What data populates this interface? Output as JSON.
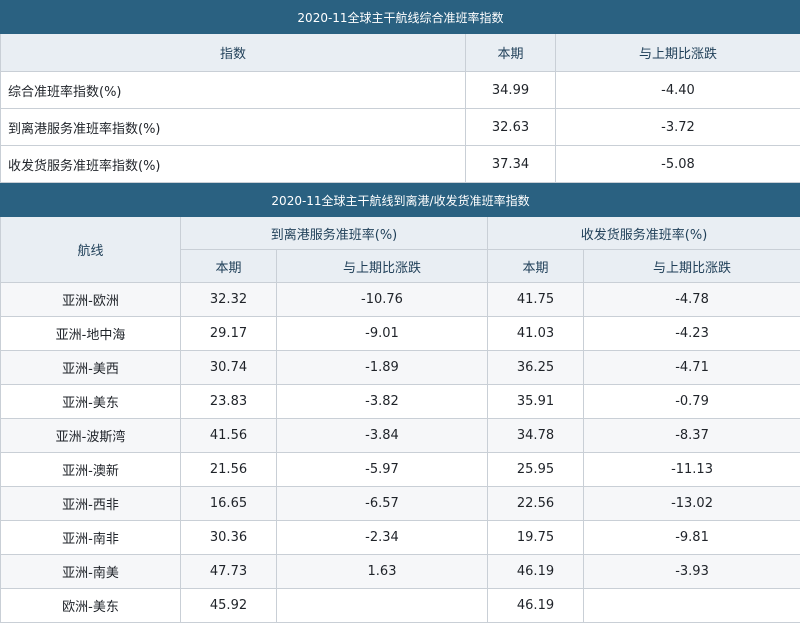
{
  "table1": {
    "title": "2020-11全球主干航线综合准班率指数",
    "headers": [
      "指数",
      "本期",
      "与上期比涨跌"
    ],
    "rows": [
      {
        "label": "综合准班率指数(%)",
        "current": "34.99",
        "change": "-4.40"
      },
      {
        "label": "到离港服务准班率指数(%)",
        "current": "32.63",
        "change": "-3.72"
      },
      {
        "label": "收发货服务准班率指数(%)",
        "current": "37.34",
        "change": "-5.08"
      }
    ]
  },
  "table2": {
    "title": "2020-11全球主干航线到离港/收发货准班率指数",
    "route_header": "航线",
    "group1": "到离港服务准班率(%)",
    "group2": "收发货服务准班率(%)",
    "sub_current": "本期",
    "sub_change": "与上期比涨跌",
    "rows": [
      {
        "route": "亚洲-欧洲",
        "a_cur": "32.32",
        "a_chg": "-10.76",
        "b_cur": "41.75",
        "b_chg": "-4.78"
      },
      {
        "route": "亚洲-地中海",
        "a_cur": "29.17",
        "a_chg": "-9.01",
        "b_cur": "41.03",
        "b_chg": "-4.23"
      },
      {
        "route": "亚洲-美西",
        "a_cur": "30.74",
        "a_chg": "-1.89",
        "b_cur": "36.25",
        "b_chg": "-4.71"
      },
      {
        "route": "亚洲-美东",
        "a_cur": "23.83",
        "a_chg": "-3.82",
        "b_cur": "35.91",
        "b_chg": "-0.79"
      },
      {
        "route": "亚洲-波斯湾",
        "a_cur": "41.56",
        "a_chg": "-3.84",
        "b_cur": "34.78",
        "b_chg": "-8.37"
      },
      {
        "route": "亚洲-澳新",
        "a_cur": "21.56",
        "a_chg": "-5.97",
        "b_cur": "25.95",
        "b_chg": "-11.13"
      },
      {
        "route": "亚洲-西非",
        "a_cur": "16.65",
        "a_chg": "-6.57",
        "b_cur": "22.56",
        "b_chg": "-13.02"
      },
      {
        "route": "亚洲-南非",
        "a_cur": "30.36",
        "a_chg": "-2.34",
        "b_cur": "19.75",
        "b_chg": "-9.81"
      },
      {
        "route": "亚洲-南美",
        "a_cur": "47.73",
        "a_chg": "1.63",
        "b_cur": "46.19",
        "b_chg": "-3.93"
      },
      {
        "route": "欧洲-美东",
        "a_cur": "45.92",
        "a_chg": "",
        "b_cur": "46.19",
        "b_chg": ""
      }
    ]
  },
  "colors": {
    "header_bar": "#2a6181",
    "header_cell": "#e9eef3",
    "row_alt": "#f6f7f9",
    "border": "#c9cfd6"
  }
}
